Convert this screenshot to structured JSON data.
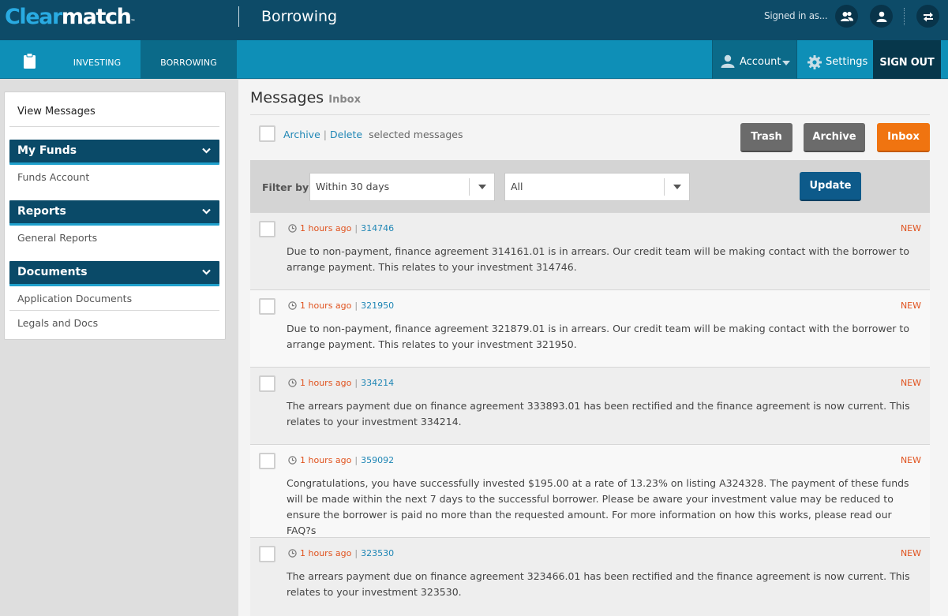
{
  "header": {
    "logo_part1": "Clear",
    "logo_part2": "match",
    "logo_tm": "™",
    "section_title": "Borrowing",
    "signed_in_text": "Signed in as..."
  },
  "nav": {
    "tabs": [
      {
        "label": "INVESTING"
      },
      {
        "label": "BORROWING"
      }
    ],
    "account_label": "Account",
    "settings_label": "Settings",
    "signout_label": "SIGN OUT"
  },
  "sidebar": {
    "view_messages": "View Messages",
    "sections": [
      {
        "title": "My Funds",
        "links": [
          "Funds Account"
        ]
      },
      {
        "title": "Reports",
        "links": [
          "General Reports"
        ]
      },
      {
        "title": "Documents",
        "links": [
          "Application Documents",
          "Legals and Docs"
        ]
      }
    ]
  },
  "main": {
    "title": "Messages",
    "subtitle": "Inbox",
    "archive_link": "Archive",
    "delete_link": "Delete",
    "selected_text": "selected messages",
    "buttons": {
      "trash": "Trash",
      "archive": "Archive",
      "inbox": "Inbox"
    },
    "filter": {
      "label": "Filter by",
      "period_value": "Within 30 days",
      "type_value": "All",
      "update_label": "Update"
    },
    "messages": [
      {
        "time": "1 hours ago",
        "ref": "314746",
        "tag": "NEW",
        "body": "Due to non-payment, finance agreement 314161.01 is in arrears. Our credit team will be making contact with the borrower to arrange payment. This relates to your investment 314746."
      },
      {
        "time": "1 hours ago",
        "ref": "321950",
        "tag": "NEW",
        "body": "Due to non-payment, finance agreement 321879.01 is in arrears. Our credit team will be making contact with the borrower to arrange payment. This relates to your investment 321950."
      },
      {
        "time": "1 hours ago",
        "ref": "334214",
        "tag": "NEW",
        "body": "The arrears payment due on finance agreement 333893.01 has been rectified and the finance agreement is now current. This relates to your investment 334214."
      },
      {
        "time": "1 hours ago",
        "ref": "359092",
        "tag": "NEW",
        "body": "Congratulations, you have successfully invested $195.00 at a rate of 13.23% on listing A324328. The payment of these funds will be made within the next 7 days to the successful borrower. Please be aware your investment value may be reduced to ensure the borrower is paid no more than the requested amount. For more information on how this works, please read our FAQ?s"
      },
      {
        "time": "1 hours ago",
        "ref": "323530",
        "tag": "NEW",
        "body": "The arrears payment due on finance agreement 323466.01 has been rectified and the finance agreement is now current. This relates to your investment 323530."
      }
    ]
  },
  "colors": {
    "header_bg": "#0d4b68",
    "nav_bg": "#0e8fb7",
    "accent_orange": "#f07410",
    "update_blue": "#0d5a8a"
  }
}
